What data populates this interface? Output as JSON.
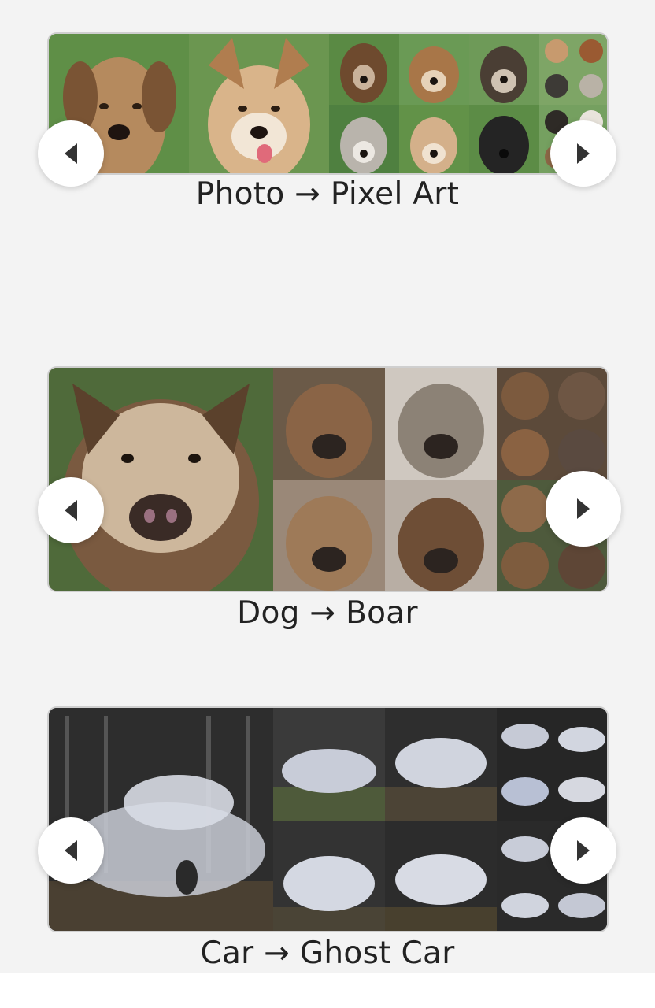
{
  "carousels": [
    {
      "caption": "Photo → Pixel Art",
      "prev_icon": "chevron-left-icon",
      "next_icon": "chevron-right-icon"
    },
    {
      "caption": "Dog → Boar",
      "prev_icon": "chevron-left-icon",
      "next_icon": "chevron-right-icon"
    },
    {
      "caption": "Car → Ghost Car",
      "prev_icon": "chevron-left-icon",
      "next_icon": "chevron-right-icon"
    }
  ],
  "colors": {
    "background": "#f3f3f3",
    "caption_text": "#222222",
    "nav_button": "#ffffff",
    "nav_arrow": "#333333"
  }
}
